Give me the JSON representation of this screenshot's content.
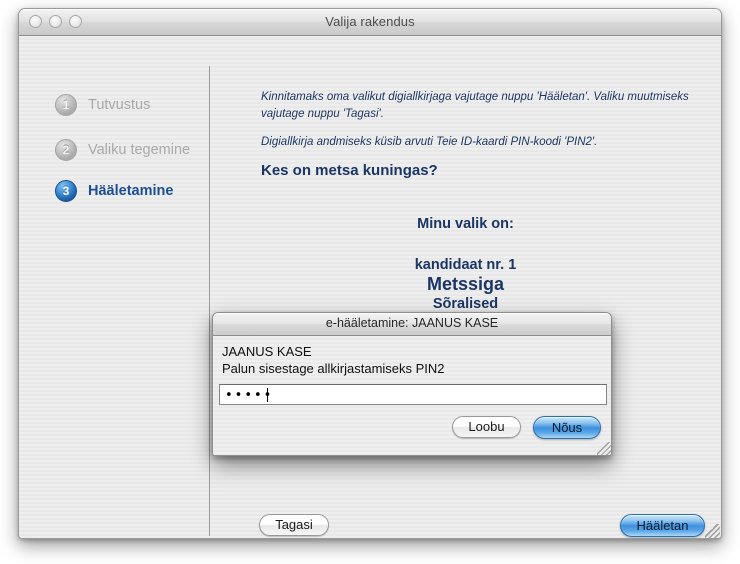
{
  "window": {
    "title": "Valija rakendus",
    "traffic_lights": [
      "close-button",
      "minimize-button",
      "zoom-button"
    ]
  },
  "sidebar": {
    "steps": [
      {
        "number": "1",
        "label": "Tutvustus",
        "state": "inactive"
      },
      {
        "number": "2",
        "label": "Valiku tegemine",
        "state": "inactive"
      },
      {
        "number": "3",
        "label": "Hääletamine",
        "state": "active"
      }
    ]
  },
  "content": {
    "intro_paragraph": "Kinnitamaks oma valikut digiallkirjaga vajutage nuppu 'Hääletan'. Valiku muutmiseks vajutage nuppu 'Tagasi'.",
    "intro_paragraph_2": "Digiallkirja andmiseks küsib arvuti Teie ID-kaardi PIN-koodi 'PIN2'.",
    "question": "Kes on metsa kuningas?",
    "choice_heading": "Minu valik on:",
    "choice_number": "kandidaat nr. 1",
    "choice_name": "Metssiga",
    "choice_party": "Sõralised"
  },
  "footer": {
    "back_label": "Tagasi",
    "vote_label": "Hääletan"
  },
  "dialog": {
    "title": "e-hääletamine: JAANUS KASE",
    "holder_name": "JAANUS KASE",
    "prompt": "Palun sisestage allkirjastamiseks PIN2",
    "pin_value": "•••••",
    "pin_masked_chars": 5,
    "cancel_label": "Loobu",
    "ok_label": "Nõus"
  },
  "colors": {
    "accent_blue": "#1b4f93",
    "navy_text": "#1b3564",
    "default_button_blue": "#3f90df",
    "disabled_grey": "#a9a9a9"
  }
}
